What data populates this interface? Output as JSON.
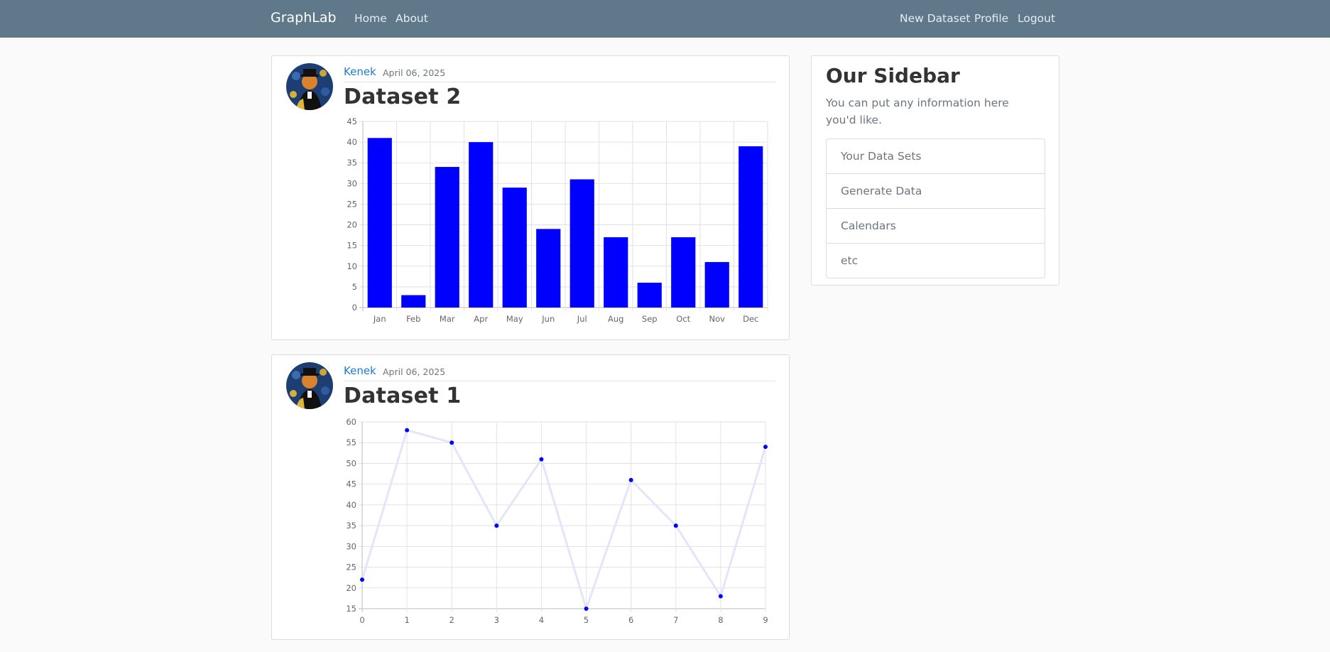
{
  "nav": {
    "brand": "GraphLab",
    "left_links": [
      "Home",
      "About"
    ],
    "right_links": [
      "New Dataset",
      "Profile",
      "Logout"
    ]
  },
  "posts": [
    {
      "author": "Kenek",
      "date": "April 06, 2025",
      "title": "Dataset 2",
      "chart_data": {
        "type": "bar",
        "categories": [
          "Jan",
          "Feb",
          "Mar",
          "Apr",
          "May",
          "Jun",
          "Jul",
          "Aug",
          "Sep",
          "Oct",
          "Nov",
          "Dec"
        ],
        "values": [
          41,
          3,
          34,
          40,
          29,
          19,
          31,
          17,
          6,
          17,
          11,
          39
        ],
        "ylim": [
          0,
          45
        ],
        "yticks": [
          0,
          5,
          10,
          15,
          20,
          25,
          30,
          35,
          40,
          45
        ],
        "grid": true,
        "color": "#0000ff"
      }
    },
    {
      "author": "Kenek",
      "date": "April 06, 2025",
      "title": "Dataset 1",
      "chart_data": {
        "type": "line",
        "x": [
          0,
          1,
          2,
          3,
          4,
          5,
          6,
          7,
          8,
          9
        ],
        "values": [
          22,
          58,
          55,
          35,
          51,
          15,
          46,
          35,
          18,
          54
        ],
        "ylim": [
          15,
          60
        ],
        "yticks": [
          15,
          20,
          25,
          30,
          35,
          40,
          45,
          50,
          55,
          60
        ],
        "grid": true,
        "point_color": "#0000ff",
        "line_color": "#e4e4fa"
      }
    }
  ],
  "sidebar": {
    "title": "Our Sidebar",
    "text": "You can put any information here you'd like.",
    "items": [
      "Your Data Sets",
      "Generate Data",
      "Calendars",
      "etc"
    ]
  }
}
